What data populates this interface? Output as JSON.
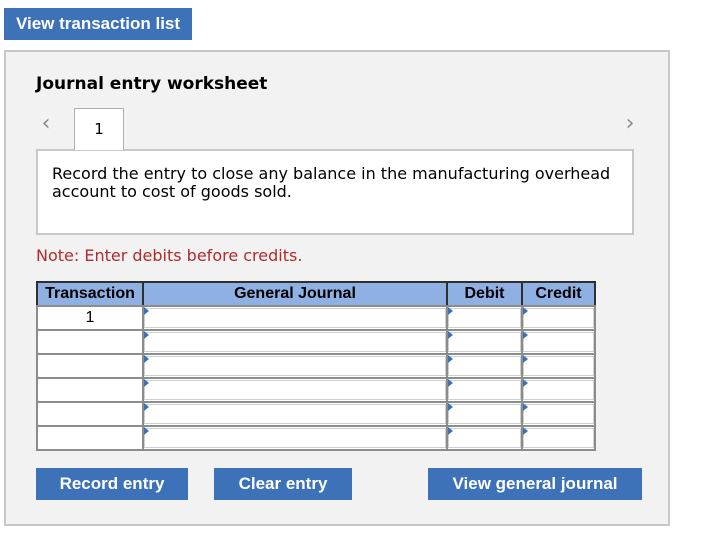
{
  "header": {
    "view_transaction_list_label": "View transaction list"
  },
  "worksheet": {
    "title": "Journal entry worksheet",
    "nav": {
      "prev_icon": "chevron-left-icon",
      "next_icon": "chevron-right-icon"
    },
    "tabs": [
      {
        "label": "1"
      }
    ],
    "instruction": "Record the entry to close any balance in the manufacturing overhead account to cost of goods sold.",
    "note": "Note: Enter debits before credits.",
    "table": {
      "columns": [
        "Transaction",
        "General Journal",
        "Debit",
        "Credit"
      ],
      "rows": [
        {
          "transaction": "1",
          "general_journal": "",
          "debit": "",
          "credit": ""
        },
        {
          "transaction": "",
          "general_journal": "",
          "debit": "",
          "credit": ""
        },
        {
          "transaction": "",
          "general_journal": "",
          "debit": "",
          "credit": ""
        },
        {
          "transaction": "",
          "general_journal": "",
          "debit": "",
          "credit": ""
        },
        {
          "transaction": "",
          "general_journal": "",
          "debit": "",
          "credit": ""
        },
        {
          "transaction": "",
          "general_journal": "",
          "debit": "",
          "credit": ""
        }
      ]
    },
    "buttons": {
      "record_entry": "Record entry",
      "clear_entry": "Clear entry",
      "view_general_journal": "View general journal"
    }
  },
  "colors": {
    "button_blue": "#3e72b8",
    "header_blue": "#8fb0e3",
    "note_red": "#b22a2a",
    "panel_gray": "#f2f2f2"
  }
}
